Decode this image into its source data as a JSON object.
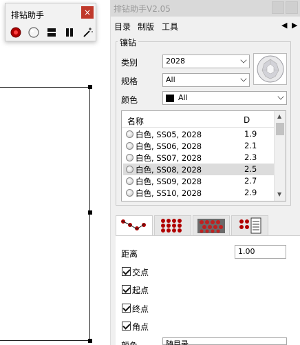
{
  "mini_palette": {
    "title": "排钻助手",
    "close": "×",
    "tools": [
      "red-gem-icon",
      "white-gem-icon",
      "two-bars-icon",
      "pause-icon",
      "magic-wand-icon"
    ]
  },
  "panel": {
    "title": "排钻助手V2.05",
    "menu": [
      "目录",
      "制版",
      "工具"
    ],
    "group_title": "镶钻",
    "fields": {
      "category_label": "类别",
      "category_value": "2028",
      "spec_label": "规格",
      "spec_value": "All",
      "color_label": "颜色",
      "color_value": "All",
      "color_swatch": "#000000"
    },
    "list": {
      "columns": [
        "名称",
        "D"
      ],
      "rows": [
        {
          "name": "白色, SS05, 2028",
          "d": "1.9"
        },
        {
          "name": "白色, SS06, 2028",
          "d": "2.1"
        },
        {
          "name": "白色, SS07, 2028",
          "d": "2.3"
        },
        {
          "name": "白色, SS08, 2028",
          "d": "2.5",
          "selected": true
        },
        {
          "name": "白色, SS09, 2028",
          "d": "2.7"
        },
        {
          "name": "白色, SS10, 2028",
          "d": "2.9"
        }
      ]
    },
    "tabs": [
      "path-tool-tab",
      "grid-tool-tab",
      "pattern-tool-tab",
      "settings-tool-tab"
    ],
    "options": {
      "distance_label": "距离",
      "distance_value": "1.00",
      "checks": [
        {
          "label": "交点",
          "checked": true
        },
        {
          "label": "起点",
          "checked": true
        },
        {
          "label": "终点",
          "checked": true
        },
        {
          "label": "角点",
          "checked": true
        }
      ],
      "bottom_label": "颜色",
      "bottom_value": "随目录"
    }
  }
}
